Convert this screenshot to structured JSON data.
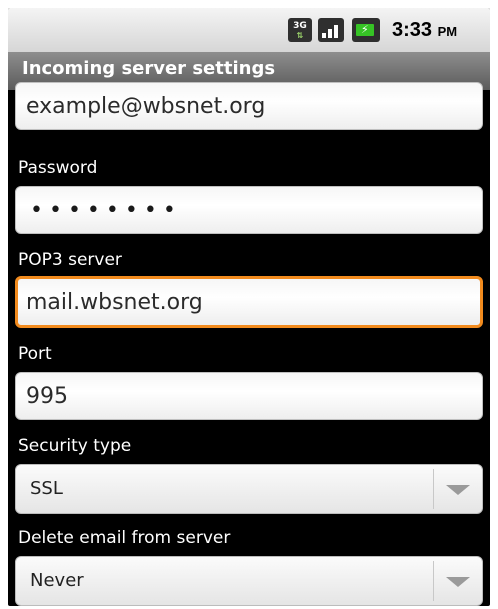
{
  "status_bar": {
    "network_type": "3G",
    "time": "3:33",
    "am_pm": "PM",
    "icons": [
      "3g-data-icon",
      "signal-strength-icon",
      "battery-charging-icon"
    ],
    "battery_color": "#36c425"
  },
  "title_bar": {
    "title": "Incoming server settings"
  },
  "form": {
    "username_value": "example@wbsnet.org",
    "password_label": "Password",
    "password_value": "••••••••",
    "pop3_label": "POP3 server",
    "pop3_value": "mail.wbsnet.org",
    "port_label": "Port",
    "port_value": "995",
    "security_label": "Security type",
    "security_value": "SSL",
    "delete_label": "Delete email from server",
    "delete_value": "Never"
  },
  "colors": {
    "focus_border": "#f28b1e",
    "background": "#000000",
    "title_bar": "#6f6f6f"
  }
}
